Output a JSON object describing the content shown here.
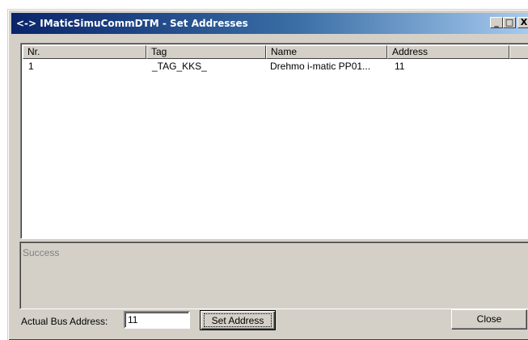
{
  "window": {
    "title": "<-> IMaticSimuCommDTM - Set Addresses",
    "buttons": {
      "minimize": "_",
      "maximize": "□",
      "close": "X"
    }
  },
  "table": {
    "columns": [
      "Nr.",
      "Tag",
      "Name",
      "Address"
    ],
    "rows": [
      {
        "nr": "1",
        "tag": "_TAG_KKS_",
        "name": "Drehmo i-matic PP01...",
        "address": "11"
      }
    ]
  },
  "status": {
    "message": "Success"
  },
  "bus_address": {
    "label": "Actual Bus Address:",
    "value": "11"
  },
  "buttons": {
    "set_address": "Set Address",
    "close": "Close"
  }
}
